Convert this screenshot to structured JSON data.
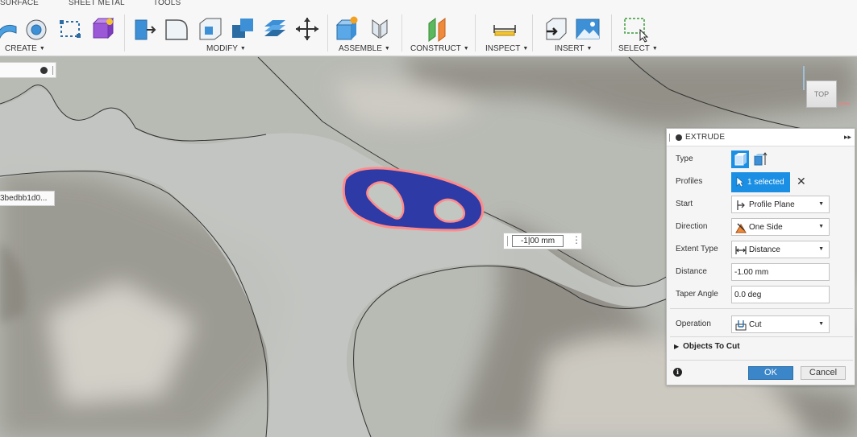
{
  "toolbar": {
    "tabs": [
      "SURFACE",
      "SHEET METAL",
      "TOOLS"
    ],
    "groups": {
      "create": "CREATE",
      "modify": "MODIFY",
      "assemble": "ASSEMBLE",
      "construct": "CONSTRUCT",
      "inspect": "INSPECT",
      "insert": "INSERT",
      "select": "SELECT"
    },
    "icons": {
      "create": [
        "patch-surface-icon",
        "revolve-surface-icon",
        "sketch-dimension-icon",
        "box-form-icon"
      ],
      "modify": [
        "press-pull-icon",
        "fillet-icon",
        "shell-icon",
        "combine-icon",
        "offset-face-icon",
        "move-icon"
      ],
      "assemble": [
        "new-component-icon",
        "joint-icon"
      ],
      "construct": [
        "offset-plane-icon"
      ],
      "inspect": [
        "measure-icon"
      ],
      "insert": [
        "insert-mesh-icon",
        "insert-image-icon"
      ],
      "select": [
        "window-select-icon"
      ]
    }
  },
  "viewport": {
    "canvas_tag": "3bedbb1d0...",
    "viewcube_face": "TOP",
    "dimension_value": "-1|00 mm",
    "colors": {
      "profile_fill": "#2e3aa6",
      "profile_outline": "#ff8a8a",
      "ground": "#bcc0bc"
    }
  },
  "extrude": {
    "title": "EXTRUDE",
    "type_label": "Type",
    "profiles_label": "Profiles",
    "profiles_value": "1 selected",
    "start_label": "Start",
    "start_value": "Profile Plane",
    "direction_label": "Direction",
    "direction_value": "One Side",
    "extent_label": "Extent Type",
    "extent_value": "Distance",
    "distance_label": "Distance",
    "distance_value": "-1.00 mm",
    "taper_label": "Taper Angle",
    "taper_value": "0.0 deg",
    "operation_label": "Operation",
    "operation_value": "Cut",
    "objects_label": "Objects To Cut",
    "ok_label": "OK",
    "cancel_label": "Cancel",
    "accent": "#1a8fe3"
  }
}
